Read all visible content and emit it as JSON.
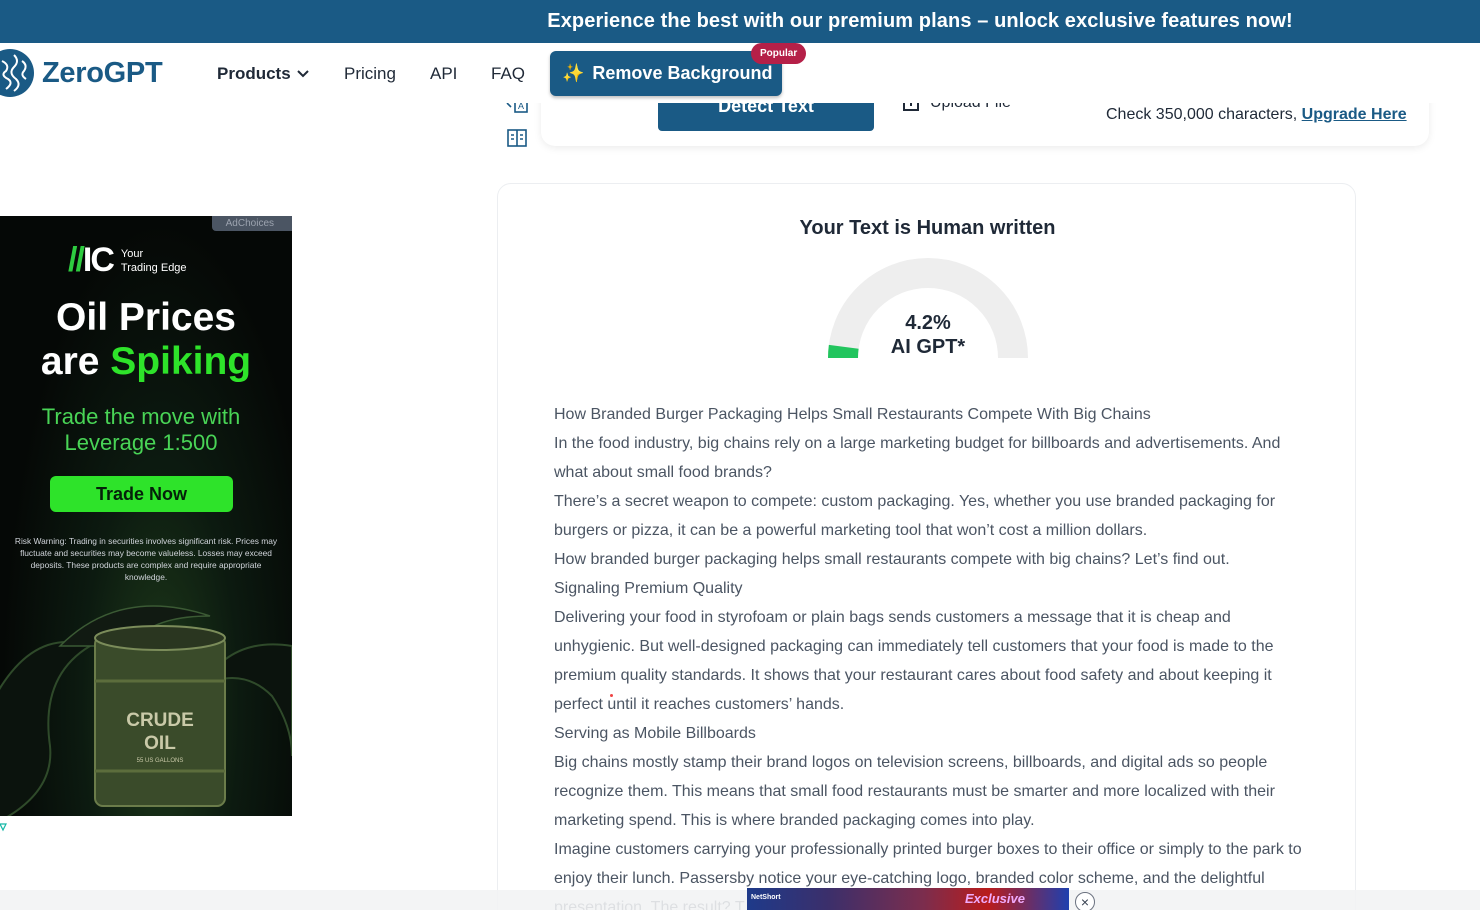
{
  "promo_banner": {
    "text": "Experience the best with our premium plans – unlock exclusive features now!"
  },
  "header": {
    "logo_text": "ZeroGPT",
    "nav": {
      "products": "Products",
      "pricing": "Pricing",
      "api": "API",
      "faq": "FAQ"
    },
    "remove_background_label": "Remove Background",
    "popular_badge": "Popular"
  },
  "detector": {
    "detect_button_label": "Detect Text",
    "upload_label": "Upload File",
    "check_text": "Check 350,000 characters,",
    "upgrade_link": "Upgrade Here"
  },
  "left_ad": {
    "adchoices": "AdChoices",
    "brand_tagline_1": "Your",
    "brand_tagline_2": "Trading Edge",
    "headline_1": "Oil Prices",
    "headline_2_a": "are",
    "headline_2_b": "Spiking",
    "sub_1": "Trade the move with",
    "sub_2": "Leverage 1:500",
    "cta": "Trade Now",
    "risk_warning": "Risk Warning: Trading in securities involves significant risk. Prices may fluctuate and securities may become valueless. Losses may exceed deposits. These products are complex and require appropriate knowledge.",
    "barrel_text_1": "CRUDE",
    "barrel_text_2": "OIL",
    "barrel_text_3": "55 US GALLONS"
  },
  "result": {
    "title": "Your Text is Human written",
    "ai_percentage": 4.2,
    "percent_label": "4.2%",
    "ai_label": "AI GPT*",
    "gauge_color": "#22c55e",
    "gauge_track_color": "#eeeeee",
    "paragraphs": [
      "How Branded Burger Packaging Helps Small Restaurants Compete With Big Chains",
      "In the food industry, big chains rely on a large marketing budget for billboards and advertisements. And what about small food brands?",
      "There’s a secret weapon to compete: custom packaging. Yes, whether you use branded packaging for burgers or pizza, it can be a powerful marketing tool that won’t cost a million dollars.",
      "How branded burger packaging helps small restaurants compete with big chains? Let’s find out.",
      "Signaling Premium Quality",
      "Delivering your food in styrofoam or plain bags sends customers a message that it is cheap and unhygienic. But well-designed packaging can immediately tell customers that your food is made to the premium quality standards. It shows that your restaurant cares about food safety and about keeping it perfect until it reaches customers’ hands.",
      "Serving as Mobile Billboards",
      "Big chains mostly stamp their brand logos on television screens, billboards, and digital ads so people recognize them. This means that small food restaurants must be smarter and more localized with their marketing spend. This is where branded packaging comes into play.",
      "Imagine customers carrying your professionally printed burger boxes to their office or simply to the park to enjoy their lunch. Passersby notice your eye-catching logo, branded color scheme, and the delightful presentation. The result? T"
    ]
  },
  "bottom_ad": {
    "logo": "NetShort",
    "title": "Exclusive"
  },
  "colors": {
    "brand": "#1a5a85",
    "badge": "#b52048",
    "ad_green": "#2ee32a"
  }
}
